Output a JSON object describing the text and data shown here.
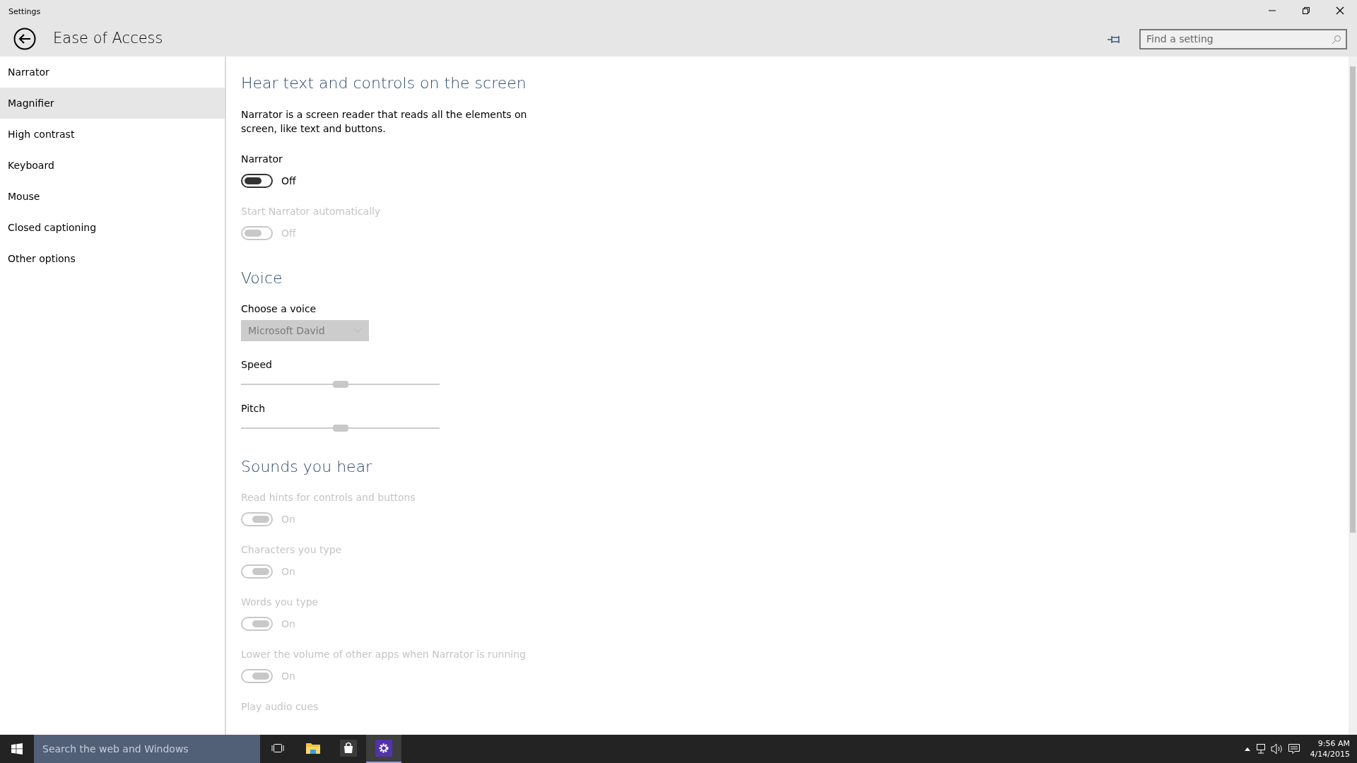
{
  "window": {
    "title": "Settings"
  },
  "header": {
    "title": "Ease of Access",
    "search": {
      "placeholder": "Find a setting"
    }
  },
  "sidebar": {
    "items": [
      {
        "label": "Narrator",
        "hovered": false
      },
      {
        "label": "Magnifier",
        "hovered": true
      },
      {
        "label": "High contrast",
        "hovered": false
      },
      {
        "label": "Keyboard",
        "hovered": false
      },
      {
        "label": "Mouse",
        "hovered": false
      },
      {
        "label": "Closed captioning",
        "hovered": false
      },
      {
        "label": "Other options",
        "hovered": false
      }
    ]
  },
  "content": {
    "sections": [
      {
        "heading": "Hear text and controls on the screen",
        "items": [
          {
            "kind": "text",
            "text": "Narrator is a screen reader that reads all the elements on screen, like text and buttons."
          },
          {
            "kind": "toggle",
            "label": "Narrator",
            "on": false,
            "disabled": false,
            "state_text": "Off"
          },
          {
            "kind": "toggle",
            "label": "Start Narrator automatically",
            "on": false,
            "disabled": true,
            "state_text": "Off"
          }
        ]
      },
      {
        "heading": "Voice",
        "items": [
          {
            "kind": "dropdown",
            "label": "Choose a voice",
            "value": "Microsoft David",
            "disabled": true
          },
          {
            "kind": "slider",
            "label": "Speed",
            "level": 0.5,
            "disabled": true
          },
          {
            "kind": "slider",
            "label": "Pitch",
            "level": 0.5,
            "disabled": true
          }
        ]
      },
      {
        "heading": "Sounds you hear",
        "items": [
          {
            "kind": "toggle",
            "label": "Read hints for controls and buttons",
            "on": true,
            "disabled": true,
            "state_text": "On"
          },
          {
            "kind": "toggle",
            "label": "Characters you type",
            "on": true,
            "disabled": true,
            "state_text": "On"
          },
          {
            "kind": "toggle",
            "label": "Words you type",
            "on": true,
            "disabled": true,
            "state_text": "On"
          },
          {
            "kind": "toggle",
            "label": "Lower the volume of other apps when Narrator is running",
            "on": true,
            "disabled": true,
            "state_text": "On"
          },
          {
            "kind": "label",
            "text": "Play audio cues",
            "disabled": true
          }
        ]
      }
    ]
  },
  "taskbar": {
    "search": {
      "placeholder": "Search the web and Windows"
    },
    "apps": [
      {
        "kind": "task-view",
        "active": false
      },
      {
        "kind": "folder",
        "active": false
      },
      {
        "kind": "store",
        "active": false
      },
      {
        "kind": "gear",
        "active": true
      }
    ],
    "clock": {
      "time": "9:56 AM",
      "date": "4/14/2015"
    }
  }
}
